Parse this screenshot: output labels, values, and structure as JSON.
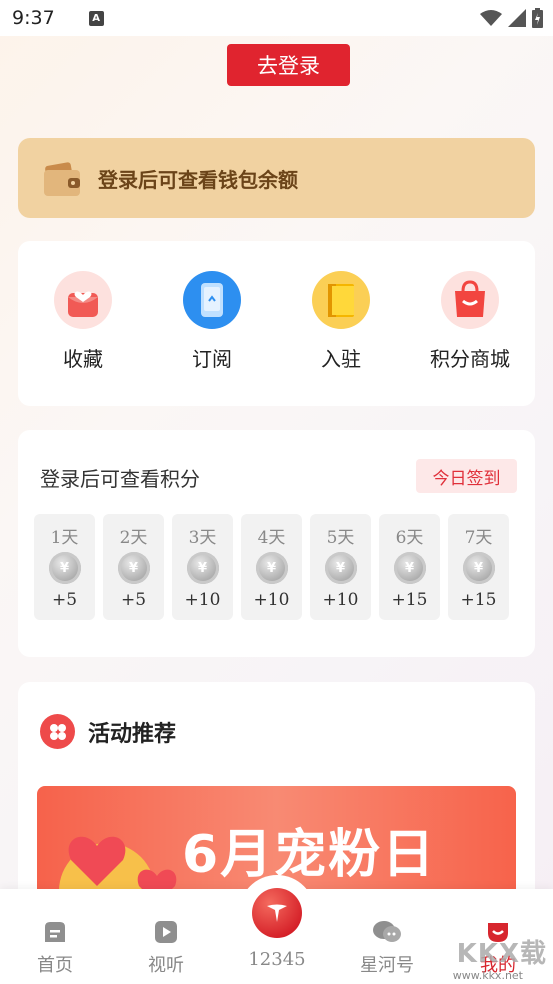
{
  "status_bar": {
    "time": "9:37",
    "notification_icon": "a-icon"
  },
  "login_button": {
    "label": "去登录"
  },
  "wallet": {
    "text": "登录后可查看钱包余额",
    "icon": "wallet-icon"
  },
  "shortcuts": [
    {
      "label": "收藏",
      "icon": "favorites-icon"
    },
    {
      "label": "订阅",
      "icon": "subscribe-icon"
    },
    {
      "label": "入驻",
      "icon": "join-icon"
    },
    {
      "label": "积分商城",
      "icon": "points-mall-icon"
    }
  ],
  "points": {
    "title": "登录后可查看积分",
    "checkin_label": "今日签到",
    "days": [
      {
        "day": "1天",
        "points": "+5"
      },
      {
        "day": "2天",
        "points": "+5"
      },
      {
        "day": "3天",
        "points": "+10"
      },
      {
        "day": "4天",
        "points": "+10"
      },
      {
        "day": "5天",
        "points": "+10"
      },
      {
        "day": "6天",
        "points": "+15"
      },
      {
        "day": "7天",
        "points": "+15"
      }
    ],
    "coin_symbol": "¥"
  },
  "activity": {
    "title": "活动推荐",
    "banner_text": "6月宠粉日"
  },
  "tabbar": [
    {
      "label": "首页",
      "icon": "home-icon"
    },
    {
      "label": "视听",
      "icon": "play-icon"
    },
    {
      "label": "12345",
      "icon": "hotline-icon"
    },
    {
      "label": "星河号",
      "icon": "chat-icon"
    },
    {
      "label": "我的",
      "icon": "profile-icon"
    }
  ],
  "watermark": {
    "big": "KKX载",
    "small": "www.kkx.net"
  },
  "colors": {
    "accent": "#e0242f",
    "wallet_bg": "#f1d2a1",
    "wallet_text": "#6b4419",
    "checkin_bg": "#fde8e8"
  }
}
